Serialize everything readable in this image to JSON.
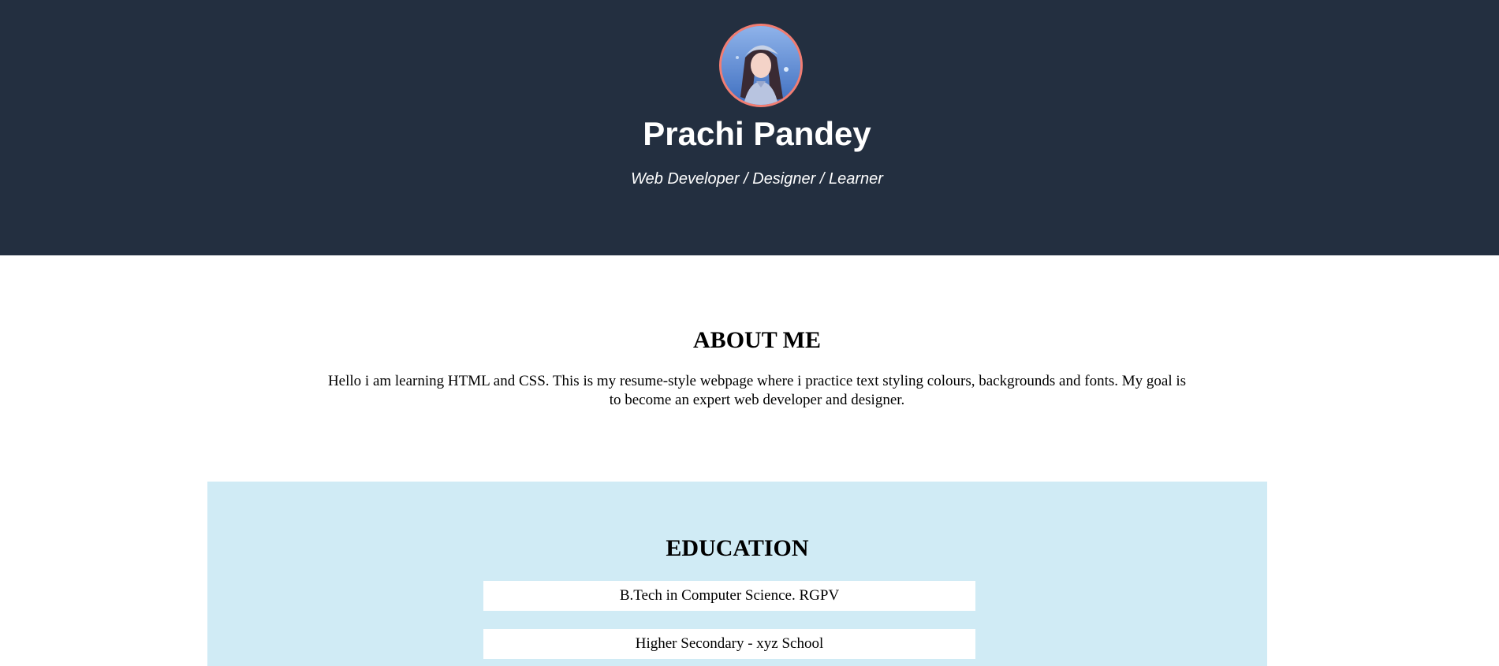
{
  "header": {
    "avatar_icon": "profile-avatar",
    "name": "Prachi Pandey",
    "tagline": "Web Developer / Designer / Learner",
    "colors": {
      "background": "#232f40",
      "avatar_border": "#f27d72",
      "text": "#ffffff"
    }
  },
  "about": {
    "title": "ABOUT ME",
    "text": "Hello i am learning HTML and CSS. This is my resume-style webpage where i practice text styling colours, backgrounds and fonts. My goal is to become an expert web developer and designer."
  },
  "education": {
    "title": "EDUCATION",
    "background": "#d0ebf5",
    "items": [
      {
        "label": "B.Tech in Computer Science. RGPV"
      },
      {
        "label": "Higher Secondary - xyz School"
      }
    ]
  }
}
